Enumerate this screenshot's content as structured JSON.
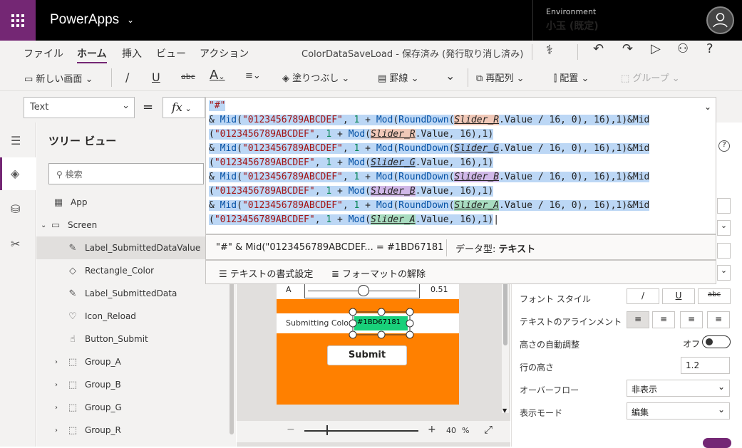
{
  "topbar": {
    "brand": "PowerApps",
    "env_label": "Environment",
    "env_value": "小玉 (既定)"
  },
  "menu": {
    "items": [
      "ファイル",
      "ホーム",
      "挿入",
      "ビュー",
      "アクション"
    ],
    "doc_status": "ColorDataSaveLoad - 保存済み (発行取り消し済み)"
  },
  "ribbon": {
    "new_screen": "新しい画面",
    "fill": "塗りつぶし",
    "border": "罫線",
    "reorder": "再配列",
    "align": "配置",
    "group": "グループ"
  },
  "formula_bar": {
    "property": "Text",
    "equals": "=",
    "fx": "fx"
  },
  "formula": {
    "line1": "\"#\"",
    "mid": "Mid",
    "digits": "\"0123456789ABCDEF\"",
    "mod": "Mod",
    "rounddown": "RoundDown",
    "sliders": [
      "Slider_R",
      "Slider_G",
      "Slider_B",
      "Slider_A"
    ],
    "value16": ".Value / 16, 0), 16),1)&Mid",
    "value16b": ".Value, 16),1)"
  },
  "formula_result": {
    "preview": "\"#\" & Mid(\"0123456789ABCDEF...",
    "equals": "=",
    "value": "#1BD67181",
    "datatype_label": "データ型:",
    "datatype_value": "テキスト"
  },
  "format_actions": {
    "format_text": "テキストの書式設定",
    "remove_format": "フォーマットの解除"
  },
  "tree": {
    "title": "ツリー ビュー",
    "search_placeholder": "検索",
    "items": [
      "App",
      "Screen",
      "Label_SubmittedDataValue",
      "Rectangle_Color",
      "Label_SubmittedData",
      "Icon_Reload",
      "Button_Submit",
      "Group_A",
      "Group_B",
      "Group_G",
      "Group_R"
    ]
  },
  "canvas": {
    "row_a_label": "A",
    "row_a_value": "0.51",
    "row_a_level": 0.51,
    "submitting_label": "Submitting Color:",
    "submitting_value": "#1BD67181",
    "submit_button": "Submit",
    "zoom_value": "40",
    "zoom_unit": "%"
  },
  "right_panel": {
    "font_style_label": "フォント スタイル",
    "align_label": "テキストのアラインメント",
    "autoheight_label": "高さの自動調整",
    "autoheight_value": "オフ",
    "lineheight_label": "行の高さ",
    "lineheight_value": "1.2",
    "overflow_label": "オーバーフロー",
    "overflow_value": "非表示",
    "displaymode_label": "表示モード",
    "displaymode_value": "編集"
  },
  "colors": {
    "accent": "#742774",
    "orange": "#ff8000",
    "green": "#19d07a"
  }
}
